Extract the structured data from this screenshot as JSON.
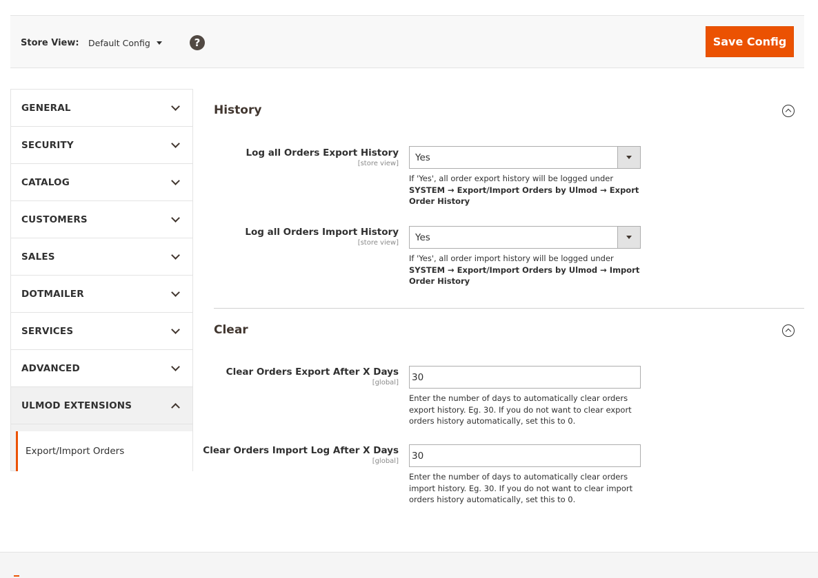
{
  "store_view": {
    "label": "Store View:",
    "value": "Default Config",
    "help": "?"
  },
  "save_button": "Save Config",
  "sidebar": {
    "items": [
      {
        "label": "GENERAL",
        "expanded": false
      },
      {
        "label": "SECURITY",
        "expanded": false
      },
      {
        "label": "CATALOG",
        "expanded": false
      },
      {
        "label": "CUSTOMERS",
        "expanded": false
      },
      {
        "label": "SALES",
        "expanded": false
      },
      {
        "label": "DOTMAILER",
        "expanded": false
      },
      {
        "label": "SERVICES",
        "expanded": false
      },
      {
        "label": "ADVANCED",
        "expanded": false
      },
      {
        "label": "ULMOD EXTENSIONS",
        "expanded": true
      }
    ],
    "sub_item": "Export/Import Orders"
  },
  "history": {
    "title": "History",
    "export": {
      "label": "Log all Orders Export History",
      "scope": "[store view]",
      "value": "Yes",
      "note_prefix": "If 'Yes', all order export history will be logged under ",
      "note_path": "SYSTEM → Export/Import Orders by Ulmod → Export Order History"
    },
    "import": {
      "label": "Log all Orders Import History",
      "scope": "[store view]",
      "value": "Yes",
      "note_prefix": "If 'Yes', all order import history will be logged under ",
      "note_path": "SYSTEM → Export/Import Orders by Ulmod → Import Order History"
    }
  },
  "clear": {
    "title": "Clear",
    "export": {
      "label": "Clear Orders Export After X Days",
      "scope": "[global]",
      "value": "30",
      "note": "Enter the number of days to automatically clear orders export history. Eg. 30. If you do not want to clear export orders history automatically, set this to 0."
    },
    "import": {
      "label": "Clear Orders Import Log After X Days",
      "scope": "[global]",
      "value": "30",
      "note": "Enter the number of days to automatically clear orders import history. Eg. 30. If you do not want to clear import orders history automatically, set this to 0."
    }
  },
  "colors": {
    "accent": "#eb5202",
    "text": "#303030",
    "border": "#adadad"
  }
}
